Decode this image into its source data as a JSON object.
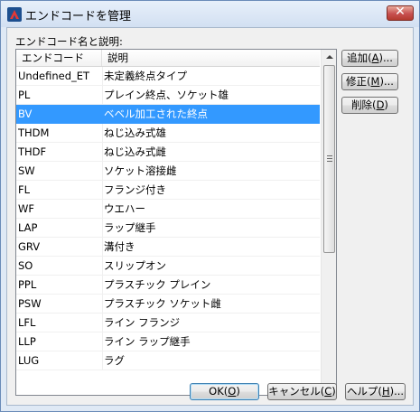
{
  "window": {
    "title": "エンドコードを管理"
  },
  "list": {
    "label": "エンドコード名と説明:",
    "columns": [
      "エンドコード",
      "説明"
    ],
    "rows": [
      {
        "code": "Undefined_ET",
        "desc": "未定義終点タイプ"
      },
      {
        "code": "PL",
        "desc": "プレイン終点、ソケット雄"
      },
      {
        "code": "BV",
        "desc": "ベベル加工された終点"
      },
      {
        "code": "THDM",
        "desc": "ねじ込み式雄"
      },
      {
        "code": "THDF",
        "desc": "ねじ込み式雌"
      },
      {
        "code": "SW",
        "desc": "ソケット溶接雌"
      },
      {
        "code": "FL",
        "desc": "フランジ付き"
      },
      {
        "code": "WF",
        "desc": "ウエハー"
      },
      {
        "code": "LAP",
        "desc": "ラップ継手"
      },
      {
        "code": "GRV",
        "desc": "溝付き"
      },
      {
        "code": "SO",
        "desc": "スリップオン"
      },
      {
        "code": "PPL",
        "desc": "プラスチック プレイン"
      },
      {
        "code": "PSW",
        "desc": "プラスチック ソケット雌"
      },
      {
        "code": "LFL",
        "desc": "ライン フランジ"
      },
      {
        "code": "LLP",
        "desc": "ライン ラップ継手"
      },
      {
        "code": "LUG",
        "desc": "ラグ"
      }
    ],
    "selected_index": 2
  },
  "buttons": {
    "add": {
      "text": "追加(",
      "key": "A",
      "tail": ")..."
    },
    "edit": {
      "text": "修正(",
      "key": "M",
      "tail": ")..."
    },
    "delete": {
      "text": "削除(",
      "key": "D",
      "tail": ")"
    },
    "ok": {
      "text": "OK(",
      "key": "O",
      "tail": ")"
    },
    "cancel": {
      "text": "キャンセル(",
      "key": "C",
      "tail": ")"
    },
    "help": {
      "text": "ヘルプ(",
      "key": "H",
      "tail": ")..."
    }
  },
  "colors": {
    "selection": "#3399ff",
    "title_bar": "#d2e0f2"
  },
  "icons": {
    "app": "autocad-app-icon",
    "close": "close-icon",
    "scroll_up": "scroll-up-arrow-icon",
    "scroll_down": "scroll-down-arrow-icon"
  }
}
